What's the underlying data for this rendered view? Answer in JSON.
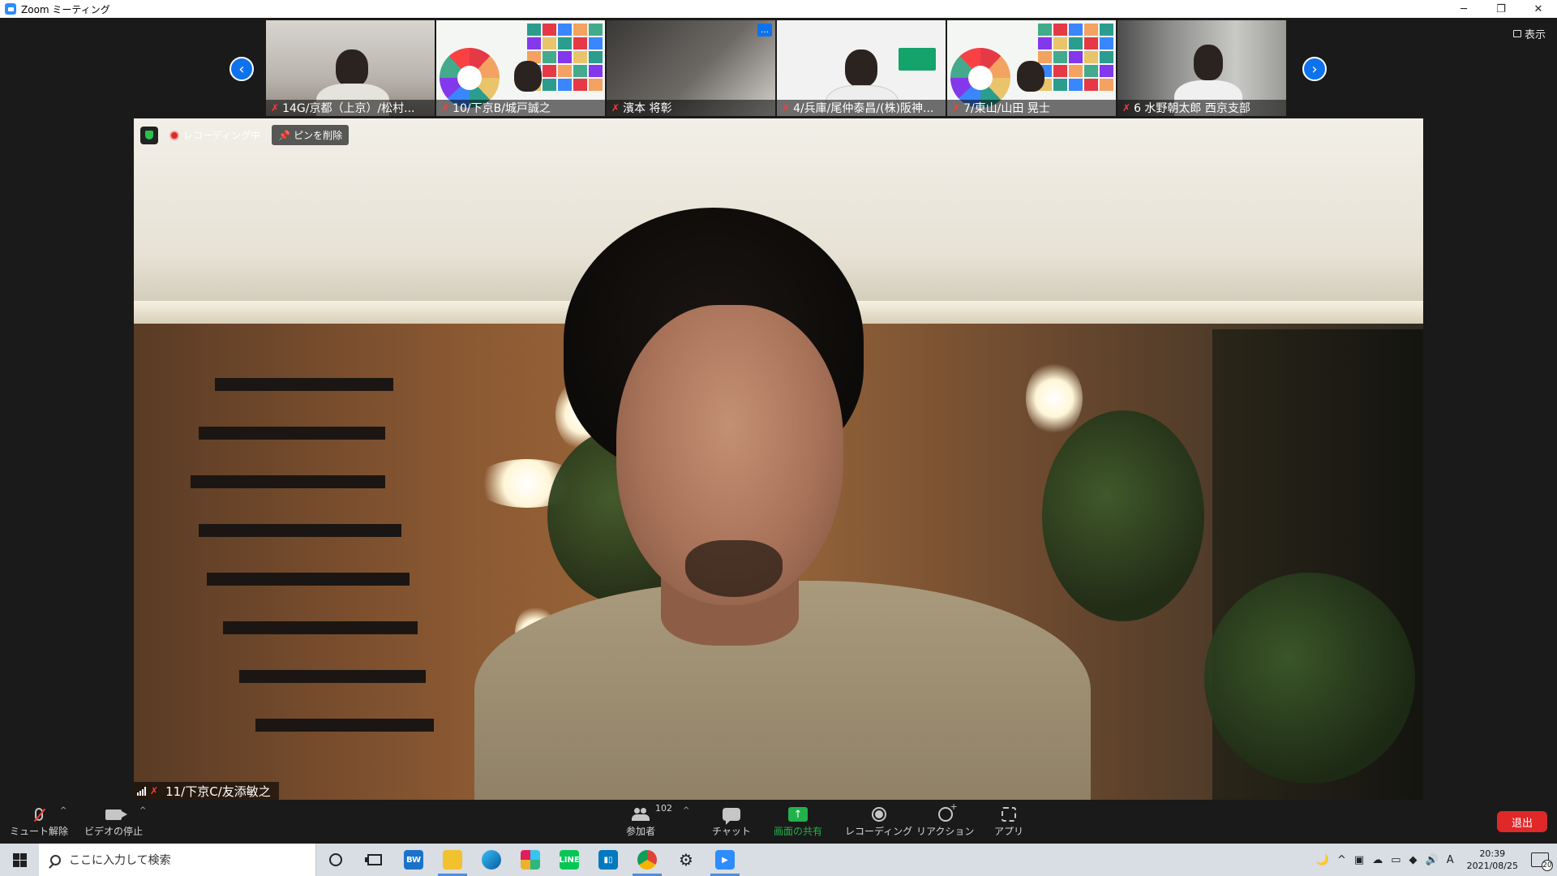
{
  "window": {
    "title": "Zoom ミーティング",
    "controls": [
      "─",
      "❐",
      "✕"
    ]
  },
  "gallery": {
    "show_label": "表示",
    "participants": [
      {
        "name": "14G/京都（上京）/松村..."
      },
      {
        "name": "10/下京B/城戸誠之"
      },
      {
        "name": "濱本 将彰"
      },
      {
        "name": "4/兵庫/尾仲泰昌/(株)阪神..."
      },
      {
        "name": "7/東山/山田 晃士"
      },
      {
        "name": "6 水野朝太郎 西京支部"
      }
    ],
    "more_icon": "…"
  },
  "main_video": {
    "recording_label": "レコーディング中",
    "unpin_label": "ピンを削除",
    "speaker_name": "11/下京C/友添敏之"
  },
  "toolbar": {
    "unmute_label": "ミュート解除",
    "stop_video_label": "ビデオの停止",
    "participants_label": "参加者",
    "participants_count": "102",
    "chat_label": "チャット",
    "share_label": "画面の共有",
    "record_label": "レコーディング",
    "reactions_label": "リアクション",
    "apps_label": "アプリ",
    "leave_label": "退出",
    "share_color": "#22b14c",
    "leave_color": "#e02828"
  },
  "taskbar": {
    "search_placeholder": "ここに入力して検索",
    "apps": [
      "bw",
      "explorer",
      "edge",
      "slack",
      "line",
      "trello",
      "chrome",
      "settings",
      "zoom"
    ],
    "clock_time": "20:39",
    "clock_date": "2021/08/25",
    "ime_label": "A",
    "notification_count": "20",
    "tray_expand": "^"
  }
}
